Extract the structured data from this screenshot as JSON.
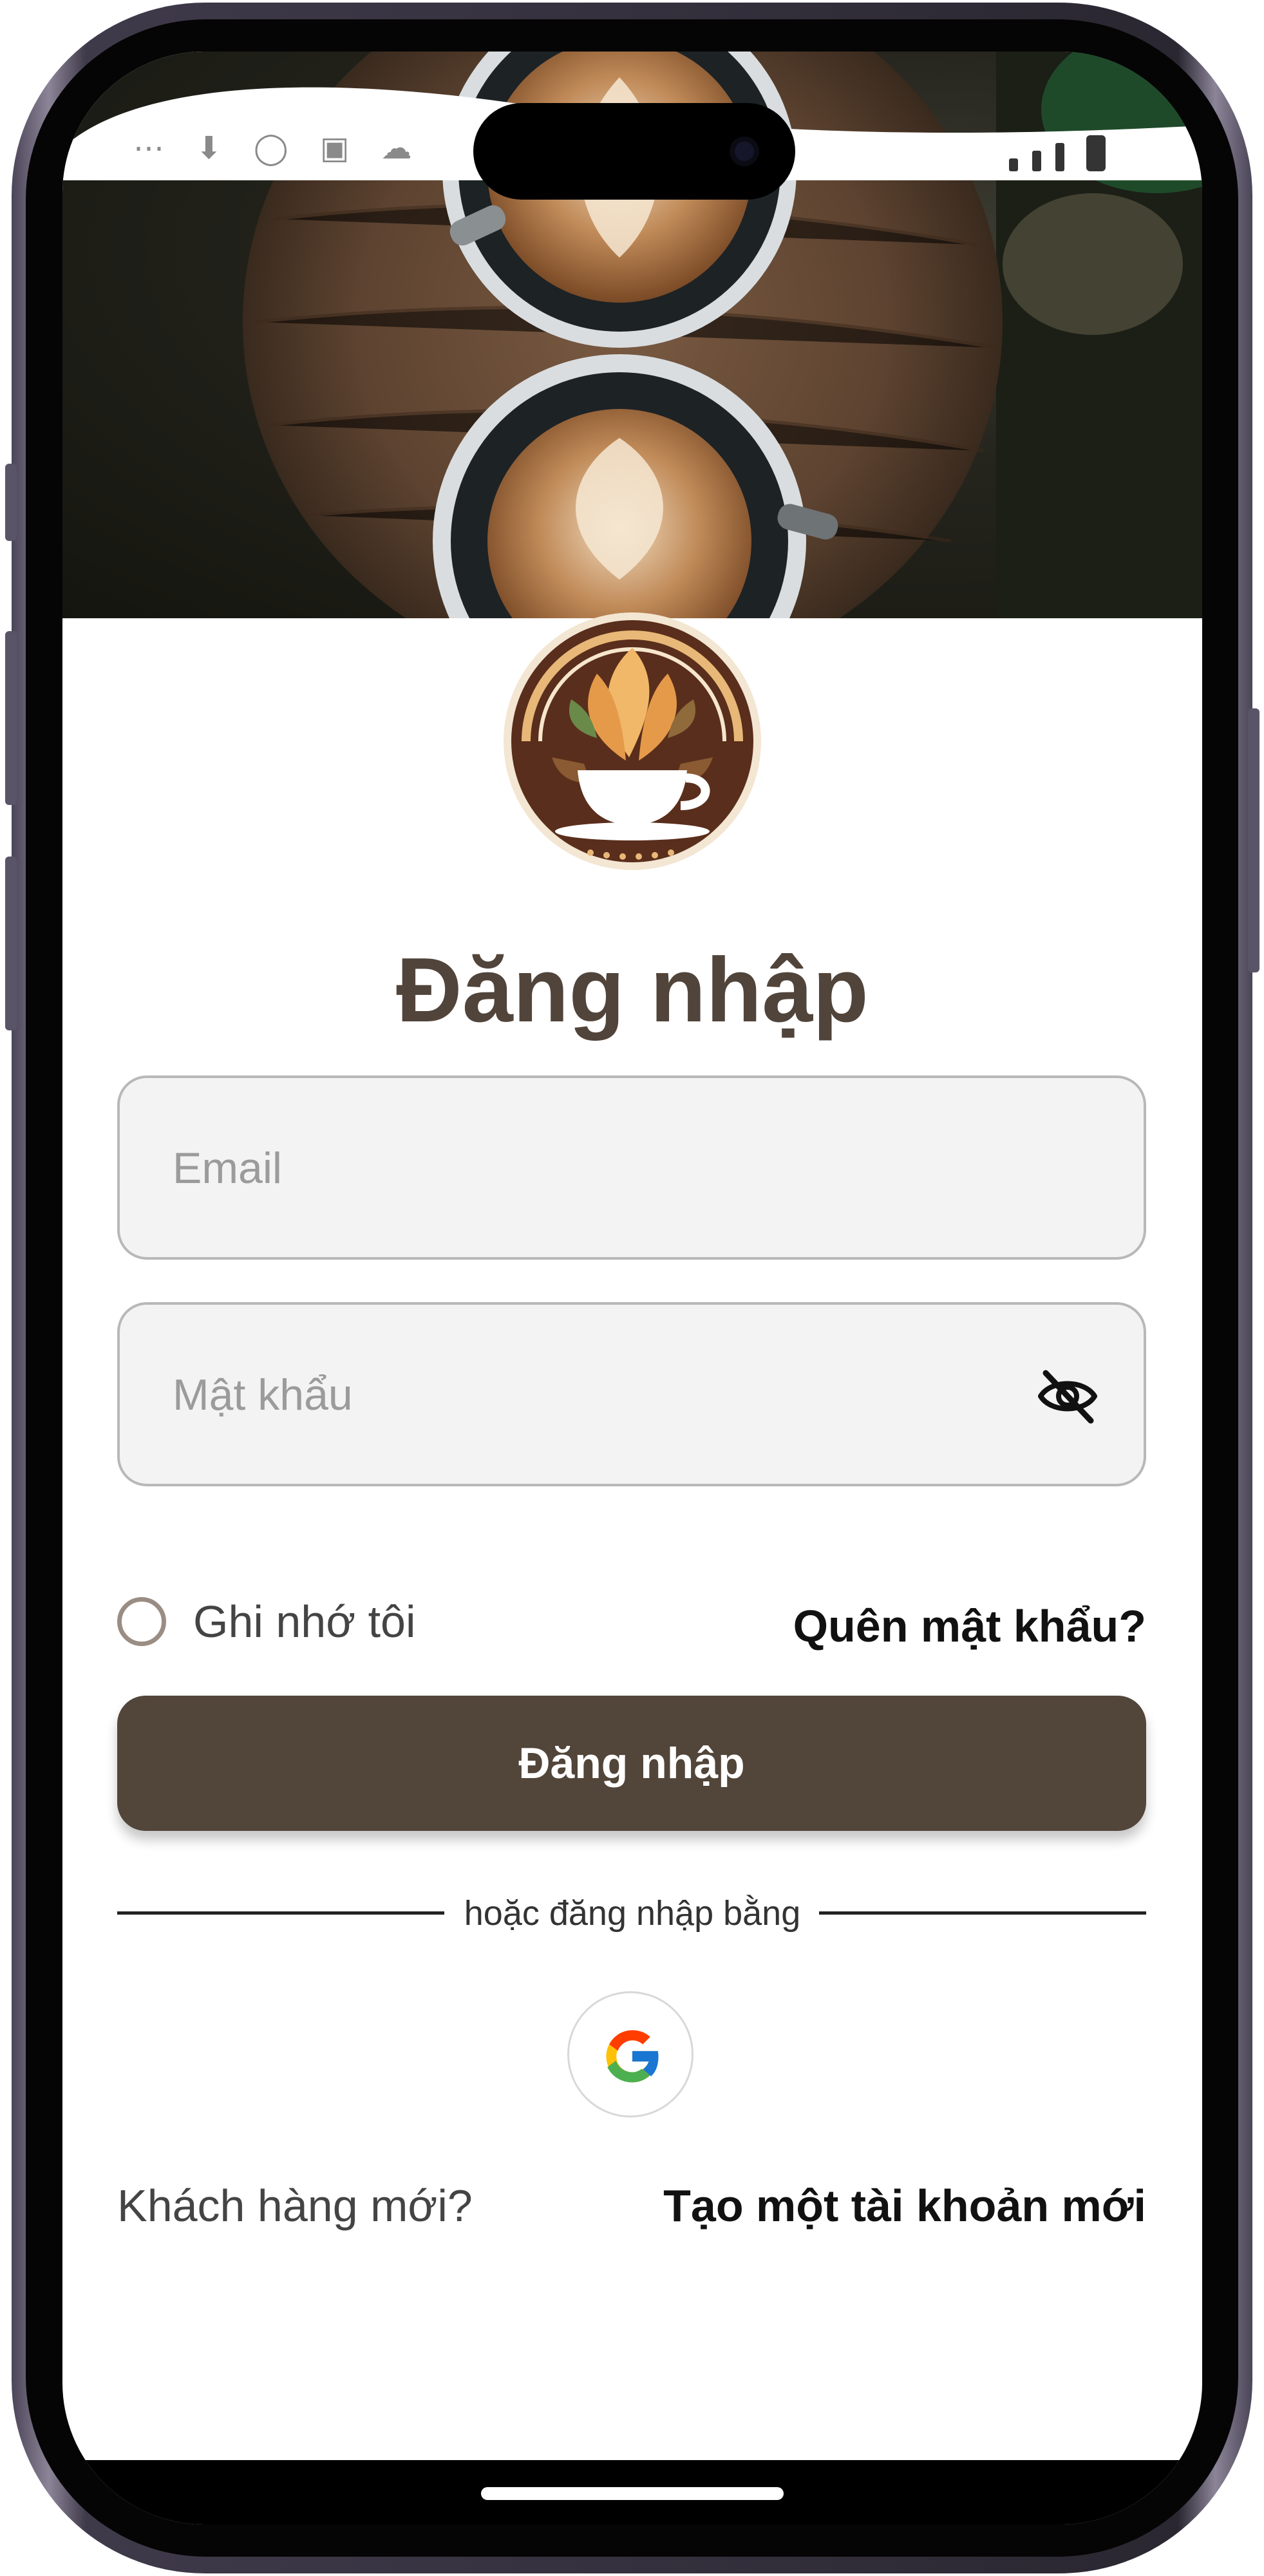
{
  "status_bar": {
    "left_glyphs": "⋯ ⬇ ◯ ▣ ☁"
  },
  "login": {
    "title": "Đăng nhập",
    "email_placeholder": "Email",
    "password_placeholder": "Mật khẩu",
    "remember_label": "Ghi nhớ tôi",
    "forgot_label": "Quên mật khẩu?",
    "submit_label": "Đăng nhập",
    "divider_label": "hoặc đăng nhập bằng",
    "new_customer_label": "Khách hàng mới?",
    "create_account_label": "Tạo một tài khoản mới"
  },
  "icons": {
    "password_toggle": "eye-off-icon",
    "social": "google-icon",
    "logo": "coffee-cup-logo"
  },
  "colors": {
    "primary": "#524539",
    "title": "#51443a",
    "field_bg": "#f3f3f3",
    "field_border": "#b8b8b8",
    "radio_border": "#9a8d84"
  }
}
